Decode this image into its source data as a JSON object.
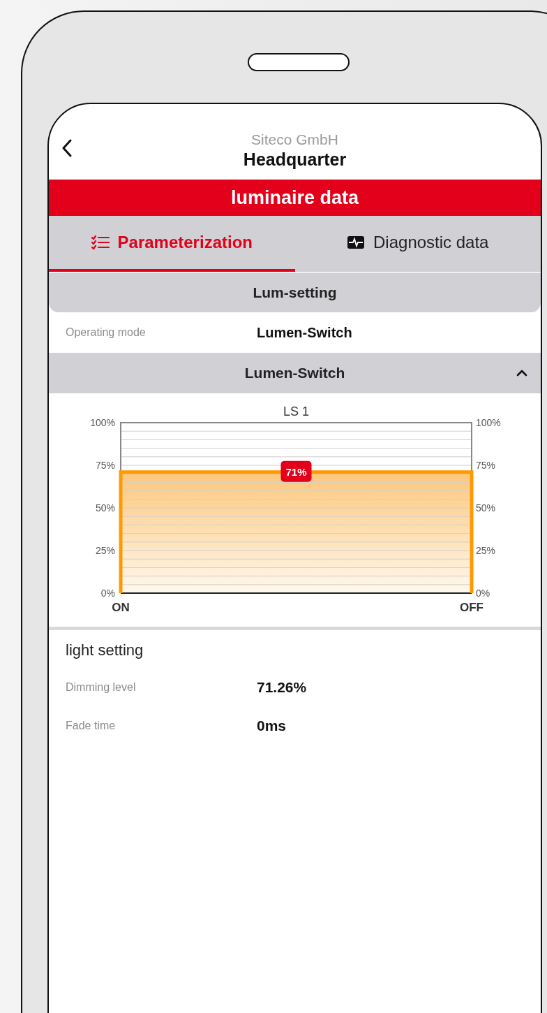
{
  "header": {
    "subtitle": "Siteco GmbH",
    "title": "Headquarter"
  },
  "banner": "luminaire data",
  "tabs": [
    {
      "label": "Parameterization",
      "selected": true
    },
    {
      "label": "Diagnostic data",
      "selected": false
    }
  ],
  "section": {
    "title": "Lum-setting"
  },
  "operating_mode": {
    "label": "Operating mode",
    "value": "Lumen-Switch"
  },
  "accordion": {
    "title": "Lumen-Switch",
    "expanded": true,
    "chart_data": {
      "type": "area",
      "title": "LS 1",
      "categories": [
        "ON",
        "OFF"
      ],
      "series": [
        {
          "color": "#ff9900",
          "values": [
            71,
            71
          ]
        }
      ],
      "ylim": [
        0,
        100
      ],
      "yticks": [
        {
          "value": 0,
          "label": "0%"
        },
        {
          "value": 25,
          "label": "25%"
        },
        {
          "value": 50,
          "label": "50%"
        },
        {
          "value": 75,
          "label": "75%"
        },
        {
          "value": 100,
          "label": "100%"
        }
      ],
      "value_labels": [
        "71%"
      ]
    },
    "right_axis_labels": [
      "100%",
      "75%",
      "50%",
      "25%",
      "0%"
    ]
  },
  "light_setting": {
    "title": "light setting",
    "rows": [
      {
        "label": "Dimming level",
        "value": "71.26%"
      },
      {
        "label": "Fade time",
        "value": "0ms"
      }
    ]
  }
}
